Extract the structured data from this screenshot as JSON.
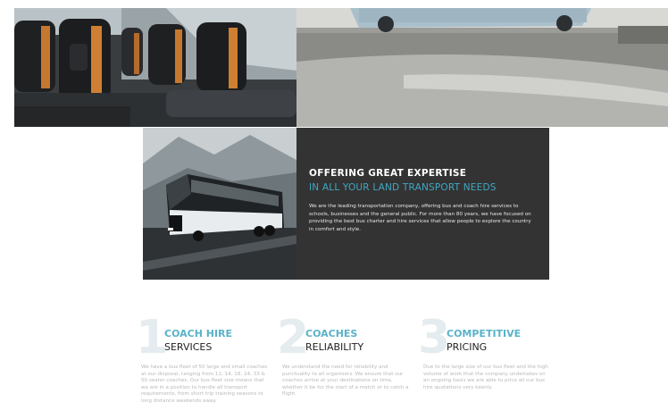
{
  "feature": {
    "title": "OFFERING GREAT EXPERTISE",
    "subtitle": "IN ALL YOUR LAND TRANSPORT NEEDS",
    "body": "We are the leading transportation company, offering bus and coach hire services to schools, businesses and the general public. For more than 80 years, we have focused on providing the best bus charter and hire services that allow people to explore the country in comfort and style."
  },
  "columns": [
    {
      "number": "1",
      "heading": "COACH HIRE",
      "subheading": "SERVICES",
      "body": "We have a bus fleet of 50 large and small coaches at our disposal, ranging from 12, 14, 18, 24, 33 & 50 seater coaches. Our bus fleet size means that we are in a position to handle all transport requirements, from short trip training seasons to long distance weekends away."
    },
    {
      "number": "2",
      "heading": "COACHES",
      "subheading": "RELIABILITY",
      "body": "We understand the need for reliability and punctuality to all organisers. We ensure that our coaches arrive at your destinations on time, whether it be for the start of a match or to catch a flight."
    },
    {
      "number": "3",
      "heading": "COMPETITIVE",
      "subheading": "PRICING",
      "body": "Due to the large size of our bus fleet and the high volume of work that the company undertakes on an ongoing basis we are able to price all our bus hire quotations very keenly."
    }
  ]
}
